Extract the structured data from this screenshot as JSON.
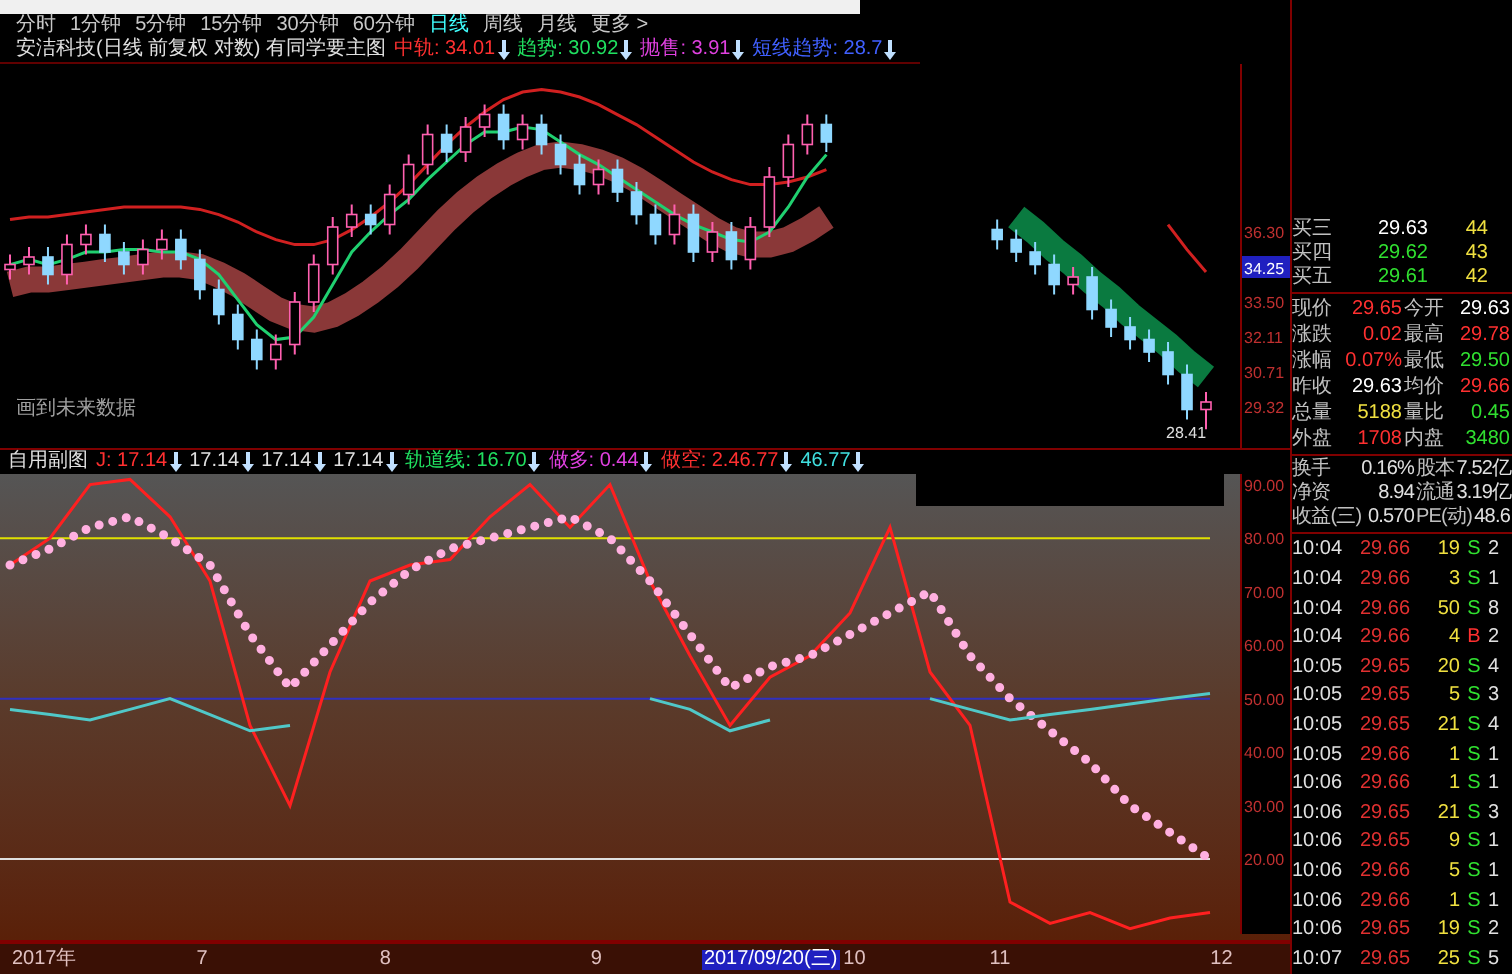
{
  "period_tabs": [
    {
      "label": "分时",
      "selected": false
    },
    {
      "label": "1分钟",
      "selected": false
    },
    {
      "label": "5分钟",
      "selected": false
    },
    {
      "label": "15分钟",
      "selected": false
    },
    {
      "label": "30分钟",
      "selected": false
    },
    {
      "label": "60分钟",
      "selected": false
    },
    {
      "label": "日线",
      "selected": true
    },
    {
      "label": "周线",
      "selected": false
    },
    {
      "label": "月线",
      "selected": false
    },
    {
      "label": "更多 >",
      "selected": false
    }
  ],
  "main_chart": {
    "title": "安洁科技(日线 前复权 对数) 有同学要主图",
    "indicators": [
      {
        "label": "中轨: 34.01",
        "color": "#ff3030"
      },
      {
        "label": "趋势: 30.92",
        "color": "#20e060"
      },
      {
        "label": "抛售: 3.91",
        "color": "#e040e0"
      },
      {
        "label": "短线趋势: 28.7",
        "color": "#4060ff"
      }
    ],
    "note": "画到未来数据",
    "cursor_price": "34.25",
    "low_marker": "28.41",
    "chart_data": {
      "type": "candlestick",
      "ylim": [
        27.66,
        43.02
      ],
      "yticks": [
        {
          "value": 36.3,
          "label": "36.30"
        },
        {
          "value": 33.5,
          "label": "33.50"
        },
        {
          "value": 32.11,
          "label": "32.11"
        },
        {
          "value": 30.71,
          "label": "30.71"
        },
        {
          "value": 29.32,
          "label": "29.32"
        }
      ],
      "ohlc": [
        [
          34.8,
          35.4,
          34.4,
          35.0
        ],
        [
          35.0,
          35.7,
          34.6,
          35.3
        ],
        [
          35.3,
          35.7,
          34.2,
          34.6
        ],
        [
          34.6,
          36.2,
          34.2,
          35.8
        ],
        [
          35.8,
          36.6,
          35.4,
          36.2
        ],
        [
          36.2,
          36.6,
          35.1,
          35.5
        ],
        [
          35.5,
          35.9,
          34.6,
          35.0
        ],
        [
          35.0,
          36.0,
          34.6,
          35.6
        ],
        [
          35.6,
          36.4,
          35.2,
          36.0
        ],
        [
          36.0,
          36.4,
          34.8,
          35.2
        ],
        [
          35.2,
          35.6,
          33.6,
          34.0
        ],
        [
          34.0,
          34.4,
          32.6,
          33.0
        ],
        [
          33.0,
          33.4,
          31.6,
          32.0
        ],
        [
          32.0,
          32.4,
          30.8,
          31.2
        ],
        [
          31.2,
          32.2,
          30.8,
          31.8
        ],
        [
          31.8,
          33.9,
          31.4,
          33.5
        ],
        [
          33.5,
          35.4,
          33.1,
          35.0
        ],
        [
          35.0,
          36.9,
          34.6,
          36.5
        ],
        [
          36.5,
          37.4,
          36.1,
          37.0
        ],
        [
          37.0,
          37.4,
          36.2,
          36.6
        ],
        [
          36.6,
          38.2,
          36.2,
          37.8
        ],
        [
          37.8,
          39.4,
          37.4,
          39.0
        ],
        [
          39.0,
          40.6,
          38.6,
          40.2
        ],
        [
          40.2,
          40.6,
          39.1,
          39.5
        ],
        [
          39.5,
          40.9,
          39.1,
          40.5
        ],
        [
          40.5,
          41.4,
          40.1,
          41.0
        ],
        [
          41.0,
          41.4,
          39.6,
          40.0
        ],
        [
          40.0,
          41.0,
          39.6,
          40.6
        ],
        [
          40.6,
          41.0,
          39.4,
          39.8
        ],
        [
          39.8,
          40.2,
          38.6,
          39.0
        ],
        [
          39.0,
          39.4,
          37.8,
          38.2
        ],
        [
          38.2,
          39.2,
          37.8,
          38.8
        ],
        [
          38.8,
          39.2,
          37.5,
          37.9
        ],
        [
          37.9,
          38.3,
          36.6,
          37.0
        ],
        [
          37.0,
          37.4,
          35.8,
          36.2
        ],
        [
          36.2,
          37.4,
          35.8,
          37.0
        ],
        [
          37.0,
          37.4,
          35.1,
          35.5
        ],
        [
          35.5,
          36.7,
          35.1,
          36.3
        ],
        [
          36.3,
          36.7,
          34.8,
          35.2
        ],
        [
          35.2,
          36.9,
          34.8,
          36.5
        ],
        [
          36.5,
          38.9,
          36.1,
          38.5
        ],
        [
          38.5,
          40.2,
          38.1,
          39.8
        ],
        [
          39.8,
          41.0,
          39.4,
          40.6
        ],
        [
          40.6,
          41.0,
          39.5,
          39.9
        ],
        null,
        null,
        null,
        null,
        null,
        null,
        null,
        null,
        [
          36.4,
          36.8,
          35.6,
          36.0
        ],
        [
          36.0,
          36.4,
          35.1,
          35.5
        ],
        [
          35.5,
          35.9,
          34.6,
          35.0
        ],
        [
          35.0,
          35.4,
          33.8,
          34.2
        ],
        [
          34.2,
          34.9,
          33.8,
          34.5
        ],
        [
          34.5,
          34.9,
          32.8,
          33.2
        ],
        [
          33.2,
          33.6,
          32.1,
          32.5
        ],
        [
          32.5,
          32.9,
          31.6,
          32.0
        ],
        [
          32.0,
          32.4,
          31.1,
          31.5
        ],
        [
          31.5,
          31.9,
          30.2,
          30.6
        ],
        [
          30.6,
          31.0,
          28.8,
          29.2
        ],
        [
          29.2,
          29.9,
          28.41,
          29.5
        ]
      ],
      "series": [
        {
          "type": "line",
          "color": "#8a3838",
          "line_style": "solid",
          "values": [
            34.2,
            34.4,
            34.4,
            34.5,
            34.6,
            34.7,
            34.8,
            34.9,
            35.0,
            35.0,
            34.9,
            34.6,
            34.2,
            33.7,
            33.2,
            32.9,
            32.8,
            33.0,
            33.4,
            33.9,
            34.5,
            35.2,
            36.0,
            36.8,
            37.5,
            38.1,
            38.6,
            39.0,
            39.3,
            39.4,
            39.3,
            39.1,
            38.8,
            38.4,
            37.9,
            37.4,
            36.9,
            36.4,
            36.0,
            35.8,
            35.8,
            36.0,
            36.4,
            36.9,
            null,
            null,
            null,
            null,
            null,
            null,
            null,
            null,
            null,
            null,
            null,
            null,
            null,
            null,
            null,
            null,
            null,
            null,
            null,
            null
          ]
        },
        {
          "type": "line",
          "color": "#0a7a40",
          "line_style": "solid",
          "values": [
            null,
            null,
            null,
            null,
            null,
            null,
            null,
            null,
            null,
            null,
            null,
            null,
            null,
            null,
            null,
            null,
            null,
            null,
            null,
            null,
            null,
            null,
            null,
            null,
            null,
            null,
            null,
            null,
            null,
            null,
            null,
            null,
            null,
            null,
            null,
            null,
            null,
            null,
            null,
            null,
            null,
            null,
            null,
            null,
            null,
            null,
            null,
            null,
            null,
            null,
            null,
            null,
            null,
            36.9,
            36.3,
            35.6,
            35.0,
            34.3,
            33.7,
            33.0,
            32.4,
            31.8,
            31.1,
            30.5
          ]
        },
        {
          "type": "line",
          "color": "#d02020",
          "line_style": "solid",
          "values": [
            36.8,
            36.9,
            36.9,
            37.0,
            37.1,
            37.2,
            37.3,
            37.3,
            37.3,
            37.3,
            37.2,
            37.0,
            36.7,
            36.3,
            36.0,
            35.8,
            35.8,
            36.0,
            36.4,
            36.9,
            37.5,
            38.2,
            39.0,
            39.8,
            40.5,
            41.1,
            41.6,
            41.9,
            42.0,
            41.9,
            41.7,
            41.4,
            41.0,
            40.6,
            40.1,
            39.6,
            39.1,
            38.7,
            38.4,
            38.2,
            38.2,
            38.3,
            38.5,
            38.8,
            null,
            null,
            null,
            null,
            null,
            null,
            null,
            null,
            null,
            null,
            null,
            null,
            null,
            null,
            null,
            null,
            null,
            36.6,
            35.6,
            34.7
          ]
        },
        {
          "type": "line",
          "color": "#20d070",
          "line_style": "solid",
          "values": [
            35.0,
            35.2,
            35.0,
            35.2,
            35.5,
            35.5,
            35.6,
            35.6,
            35.5,
            35.5,
            35.2,
            34.6,
            33.6,
            32.6,
            32.0,
            32.1,
            32.9,
            34.2,
            35.5,
            36.3,
            37.0,
            37.6,
            38.4,
            39.1,
            39.8,
            40.3,
            40.3,
            40.5,
            40.4,
            39.9,
            39.4,
            39.0,
            38.5,
            38.0,
            37.5,
            37.0,
            36.6,
            36.3,
            36.0,
            35.9,
            36.3,
            37.3,
            38.5,
            39.4,
            null,
            null,
            null,
            null,
            null,
            null,
            null,
            null,
            null,
            null,
            null,
            null,
            null,
            null,
            null,
            null,
            null,
            null,
            null,
            null
          ]
        }
      ]
    }
  },
  "sub_chart": {
    "title": "自用副图",
    "indicators": [
      {
        "label": "J: 17.14",
        "color": "#ff3030"
      },
      {
        "label": "17.14",
        "color": "#e0e0e0"
      },
      {
        "label": "17.14",
        "color": "#e0e0e0"
      },
      {
        "label": "17.14",
        "color": "#e0e0e0"
      },
      {
        "label": "轨道线: 16.70",
        "color": "#20e060"
      },
      {
        "label": "做多: 0.44",
        "color": "#e040e0"
      },
      {
        "label": "做空: 2.46.77",
        "color": "#ff3030"
      },
      {
        "label": "46.77",
        "color": "#40e0e0"
      }
    ],
    "chart_data": {
      "type": "line",
      "ylim": [
        6,
        92
      ],
      "yticks": [
        {
          "value": 90,
          "label": "90.00"
        },
        {
          "value": 80,
          "label": "80.00"
        },
        {
          "value": 70,
          "label": "70.00"
        },
        {
          "value": 60,
          "label": "60.00"
        },
        {
          "value": 50,
          "label": "50.00"
        },
        {
          "value": 40,
          "label": "40.00"
        },
        {
          "value": 30,
          "label": "30.00"
        },
        {
          "value": 20,
          "label": "20.00"
        }
      ],
      "series": [
        {
          "color": "#ff2020",
          "line_style": "solid",
          "values": [
            75,
            80,
            90,
            91,
            84,
            72,
            45,
            30,
            55,
            72,
            75,
            76,
            84,
            90,
            82,
            90,
            72,
            58,
            45,
            54,
            58,
            66,
            82,
            55,
            45,
            12,
            8,
            10,
            7,
            9,
            10
          ]
        },
        {
          "color": "#ffb0e0",
          "line_style": "dotted",
          "values": [
            75,
            78,
            82,
            84,
            80,
            75,
            62,
            52,
            60,
            68,
            74,
            78,
            80,
            82,
            84,
            80,
            72,
            62,
            52,
            56,
            58,
            62,
            66,
            70,
            58,
            50,
            44,
            38,
            30,
            25,
            20
          ]
        },
        {
          "color": "#50c8c8",
          "line_style": "solid",
          "values": [
            48,
            47,
            46,
            48,
            50,
            47,
            44,
            45,
            null,
            null,
            null,
            null,
            null,
            null,
            null,
            null,
            50,
            48,
            44,
            46,
            null,
            null,
            null,
            50,
            48,
            46,
            47,
            48,
            49,
            50,
            51
          ]
        }
      ],
      "ref_lines": [
        {
          "axis": "y",
          "value": 80,
          "color": "#e0e000"
        },
        {
          "axis": "y",
          "value": 50,
          "color": "#3030c0"
        },
        {
          "axis": "y",
          "value": 20,
          "color": "#e0e0e0"
        }
      ]
    }
  },
  "date_axis": [
    {
      "label": "2017年",
      "selected": false
    },
    {
      "label": "7",
      "selected": false
    },
    {
      "label": "8",
      "selected": false
    },
    {
      "label": "9",
      "selected": false
    },
    {
      "label": "2017/09/20(三)",
      "selected": true
    },
    {
      "label": "10",
      "selected": false
    },
    {
      "label": "11",
      "selected": false
    },
    {
      "label": "12",
      "selected": false
    }
  ],
  "quote": {
    "bids": [
      {
        "label": "买三",
        "price": "29.63",
        "volume": "44",
        "color": "#ffffff"
      },
      {
        "label": "买四",
        "price": "29.62",
        "volume": "43",
        "color": "#30e030"
      },
      {
        "label": "买五",
        "price": "29.61",
        "volume": "42",
        "color": "#30e030"
      }
    ],
    "stats": [
      {
        "label": "现价",
        "value": "29.65",
        "color": "#ff3030"
      },
      {
        "label": "今开",
        "value": "29.63",
        "color": "#ffffff"
      },
      {
        "label": "涨跌",
        "value": "0.02",
        "color": "#ff3030"
      },
      {
        "label": "最高",
        "value": "29.78",
        "color": "#ff3030"
      },
      {
        "label": "涨幅",
        "value": "0.07%",
        "color": "#ff3030"
      },
      {
        "label": "最低",
        "value": "29.50",
        "color": "#30e030"
      },
      {
        "label": "昨收",
        "value": "29.63",
        "color": "#ffffff"
      },
      {
        "label": "均价",
        "value": "29.66",
        "color": "#ff3030"
      },
      {
        "label": "总量",
        "value": "5188",
        "color": "#f0e040"
      },
      {
        "label": "量比",
        "value": "0.45",
        "color": "#30e030"
      },
      {
        "label": "外盘",
        "value": "1708",
        "color": "#ff3030"
      },
      {
        "label": "内盘",
        "value": "3480",
        "color": "#30e030"
      }
    ],
    "fundamentals": [
      {
        "label": "换手",
        "value": "0.16%"
      },
      {
        "label": "股本",
        "value": "7.52亿"
      },
      {
        "label": "净资",
        "value": "8.94"
      },
      {
        "label": "流通",
        "value": "3.19亿"
      },
      {
        "label": "收益(三)",
        "value": "0.570"
      },
      {
        "label": "PE(动)",
        "value": "48.6"
      }
    ],
    "ticks": [
      {
        "time": "10:04",
        "price": "29.66",
        "volume": "19",
        "side": "S",
        "kind": "sell",
        "column_5": "2"
      },
      {
        "time": "10:04",
        "price": "29.66",
        "volume": "3",
        "side": "S",
        "kind": "sell",
        "column_5": "1"
      },
      {
        "time": "10:04",
        "price": "29.66",
        "volume": "50",
        "side": "S",
        "kind": "sell",
        "column_5": "8"
      },
      {
        "time": "10:04",
        "price": "29.66",
        "volume": "4",
        "side": "B",
        "kind": "buy",
        "column_5": "2"
      },
      {
        "time": "10:05",
        "price": "29.65",
        "volume": "20",
        "side": "S",
        "kind": "sell",
        "column_5": "4"
      },
      {
        "time": "10:05",
        "price": "29.65",
        "volume": "5",
        "side": "S",
        "kind": "sell",
        "column_5": "3"
      },
      {
        "time": "10:05",
        "price": "29.65",
        "volume": "21",
        "side": "S",
        "kind": "sell",
        "column_5": "4"
      },
      {
        "time": "10:05",
        "price": "29.66",
        "volume": "1",
        "side": "S",
        "kind": "sell",
        "column_5": "1"
      },
      {
        "time": "10:06",
        "price": "29.66",
        "volume": "1",
        "side": "S",
        "kind": "sell",
        "column_5": "1"
      },
      {
        "time": "10:06",
        "price": "29.65",
        "volume": "21",
        "side": "S",
        "kind": "sell",
        "column_5": "3"
      },
      {
        "time": "10:06",
        "price": "29.65",
        "volume": "9",
        "side": "S",
        "kind": "sell",
        "column_5": "1"
      },
      {
        "time": "10:06",
        "price": "29.66",
        "volume": "5",
        "side": "S",
        "kind": "sell",
        "column_5": "1"
      },
      {
        "time": "10:06",
        "price": "29.66",
        "volume": "1",
        "side": "S",
        "kind": "sell",
        "column_5": "1"
      },
      {
        "time": "10:06",
        "price": "29.65",
        "volume": "19",
        "side": "S",
        "kind": "sell",
        "column_5": "2"
      },
      {
        "time": "10:07",
        "price": "29.65",
        "volume": "25",
        "side": "S",
        "kind": "sell",
        "column_5": "5"
      }
    ]
  }
}
